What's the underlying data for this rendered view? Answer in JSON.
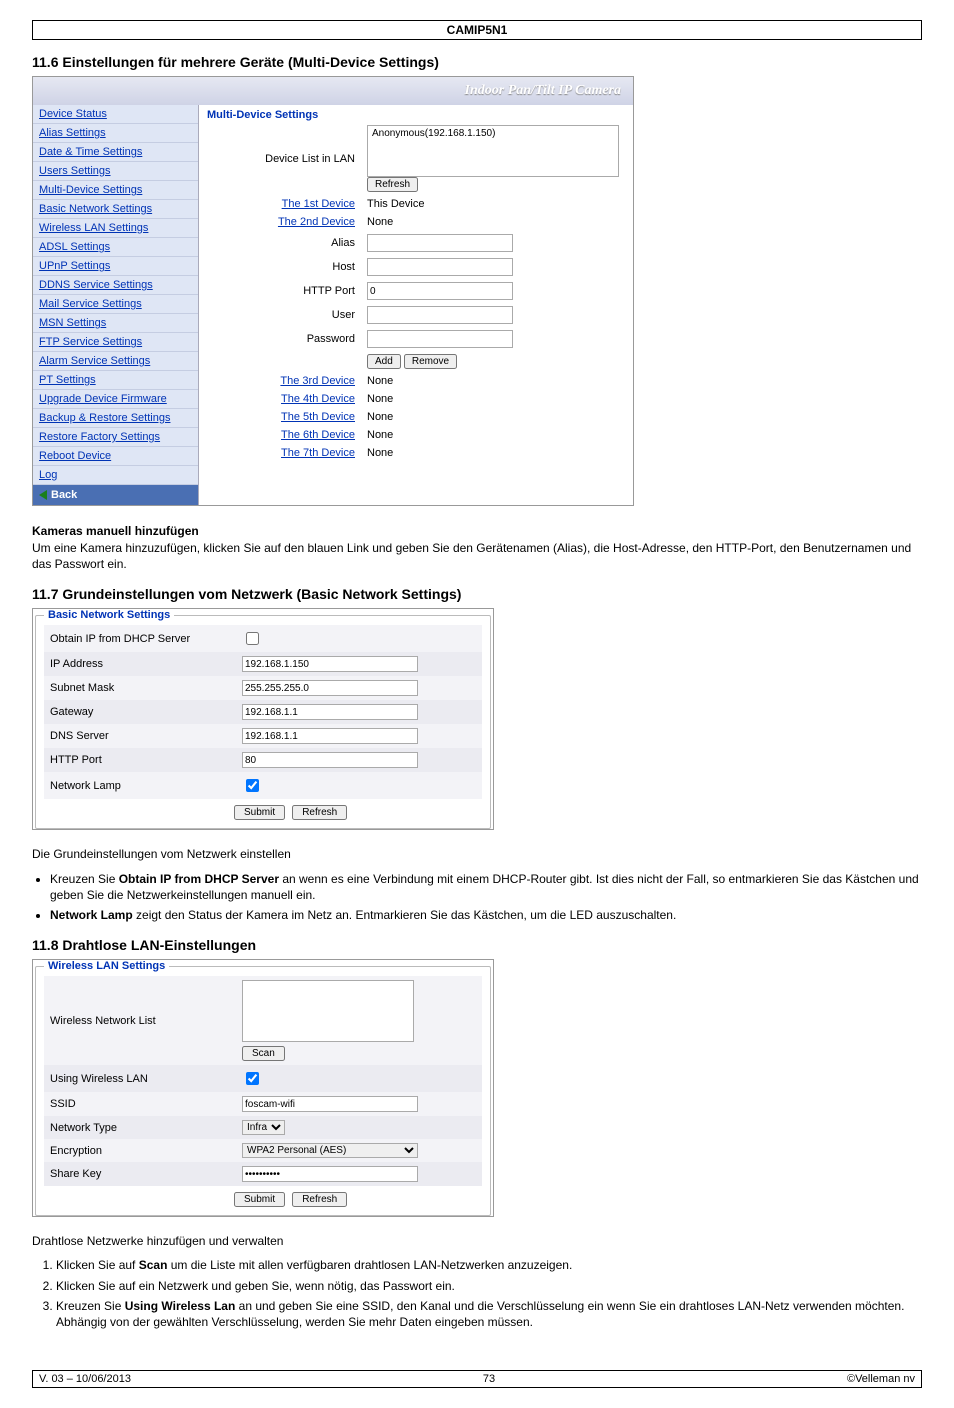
{
  "header": "CAMIP5N1",
  "section_11_6": {
    "title": "11.6  Einstellungen für mehrere Geräte (Multi-Device Settings)",
    "banner": "Indoor Pan/Tilt IP Camera",
    "side_menu": [
      "Device Status",
      "Alias Settings",
      "Date & Time Settings",
      "Users Settings",
      "Multi-Device Settings",
      "Basic Network Settings",
      "Wireless LAN Settings",
      "ADSL Settings",
      "UPnP Settings",
      "DDNS Service Settings",
      "Mail Service Settings",
      "MSN Settings",
      "FTP Service Settings",
      "Alarm Service Settings",
      "PT Settings",
      "Upgrade Device Firmware",
      "Backup & Restore Settings",
      "Restore Factory Settings",
      "Reboot Device",
      "Log"
    ],
    "back_label": "Back",
    "form": {
      "title": "Multi-Device Settings",
      "device_list_label": "Device List in LAN",
      "device_list_value": "Anonymous(192.168.1.150)",
      "refresh_btn": "Refresh",
      "dev1_label": "The 1st Device",
      "dev1_val": "This Device",
      "dev2_label": "The 2nd Device",
      "dev2_val": "None",
      "alias_lbl": "Alias",
      "host_lbl": "Host",
      "http_port_lbl": "HTTP Port",
      "http_port_val": "0",
      "user_lbl": "User",
      "password_lbl": "Password",
      "add_btn": "Add",
      "remove_btn": "Remove",
      "dev3_label": "The 3rd Device",
      "dev3_val": "None",
      "dev4_label": "The 4th Device",
      "dev4_val": "None",
      "dev5_label": "The 5th Device",
      "dev5_val": "None",
      "dev6_label": "The 6th Device",
      "dev6_val": "None",
      "dev7_label": "The 7th Device",
      "dev7_val": "None"
    },
    "subheading": "Kameras manuell hinzufügen",
    "subtext": "Um eine Kamera hinzuzufügen, klicken Sie auf den blauen Link und geben Sie den Gerätenamen (Alias), die Host-Adresse, den HTTP-Port, den Benutzernamen und das Passwort ein."
  },
  "section_11_7": {
    "title": "11.7  Grundeinstellungen vom Netzwerk (Basic Network Settings)",
    "legend": "Basic Network Settings",
    "rows": {
      "dhcp": "Obtain IP from DHCP Server",
      "ip_lbl": "IP Address",
      "ip_val": "192.168.1.150",
      "mask_lbl": "Subnet Mask",
      "mask_val": "255.255.255.0",
      "gw_lbl": "Gateway",
      "gw_val": "192.168.1.1",
      "dns_lbl": "DNS Server",
      "dns_val": "192.168.1.1",
      "http_lbl": "HTTP Port",
      "http_val": "80",
      "lamp_lbl": "Network Lamp"
    },
    "submit_btn": "Submit",
    "refresh_btn": "Refresh",
    "intro": "Die Grundeinstellungen vom Netzwerk einstellen",
    "bullet1_pre": "Kreuzen Sie ",
    "bullet1_bold": "Obtain IP from DHCP Server",
    "bullet1_post": " an wenn es eine Verbindung mit einem DHCP-Router gibt. Ist dies nicht der Fall, so entmarkieren Sie das Kästchen und geben Sie die Netzwerkeinstellungen manuell ein.",
    "bullet2_bold": "Network Lamp",
    "bullet2_post": " zeigt den Status der Kamera im Netz an. Entmarkieren Sie das Kästchen, um die LED auszuschalten."
  },
  "section_11_8": {
    "title": "11.8  Drahtlose LAN-Einstellungen",
    "legend": "Wireless LAN Settings",
    "rows": {
      "netlist": "Wireless Network List",
      "scan_btn": "Scan",
      "use_lbl": "Using Wireless LAN",
      "ssid_lbl": "SSID",
      "ssid_val": "foscam-wifi",
      "type_lbl": "Network Type",
      "type_val": "Infra",
      "enc_lbl": "Encryption",
      "enc_val": "WPA2 Personal (AES)",
      "key_lbl": "Share Key",
      "key_val": "••••••••••"
    },
    "submit_btn": "Submit",
    "refresh_btn": "Refresh",
    "intro": "Drahtlose Netzwerke hinzufügen und verwalten",
    "step1_pre": "Klicken Sie auf ",
    "step1_bold": "Scan",
    "step1_post": " um die Liste mit allen verfügbaren drahtlosen LAN-Netzwerken anzuzeigen.",
    "step2": "Klicken Sie auf ein Netzwerk und geben Sie, wenn nötig, das Passwort ein.",
    "step3_pre": "Kreuzen Sie ",
    "step3_bold": "Using Wireless Lan",
    "step3_post": " an und geben Sie eine SSID, den Kanal und die Verschlüsselung ein wenn Sie ein drahtloses LAN-Netz verwenden möchten.",
    "step3_extra": "Abhängig von der gewählten Verschlüsselung, werden Sie mehr Daten eingeben müssen."
  },
  "footer": {
    "left": "V. 03 – 10/06/2013",
    "center": "73",
    "right": "©Velleman nv"
  }
}
